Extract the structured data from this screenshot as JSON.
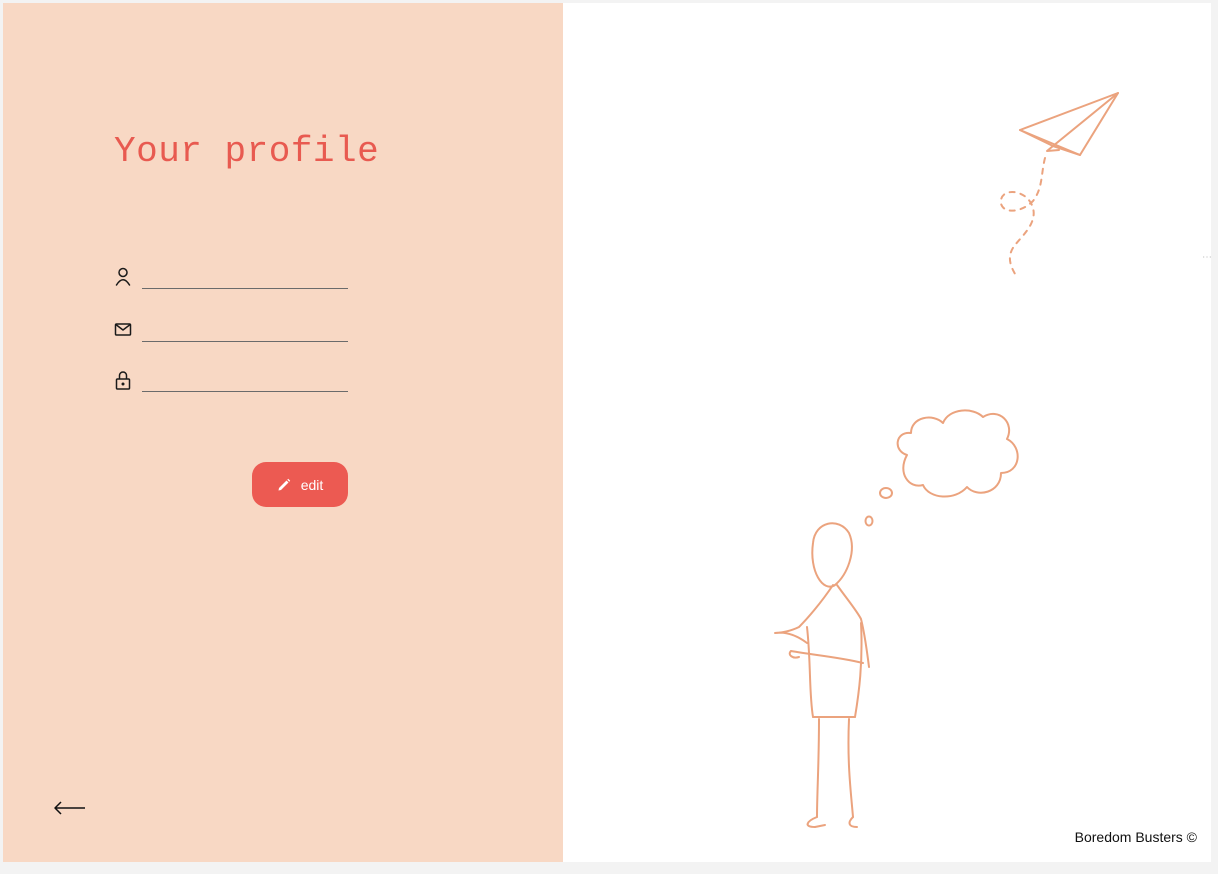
{
  "page": {
    "title": "Your profile"
  },
  "form": {
    "username": {
      "value": "",
      "placeholder": "",
      "icon": "user-icon"
    },
    "email": {
      "value": "",
      "placeholder": "",
      "icon": "mail-icon"
    },
    "password": {
      "value": "",
      "placeholder": "",
      "icon": "lock-icon"
    }
  },
  "edit_button": {
    "label": "edit",
    "icon": "pencil-icon"
  },
  "navigation": {
    "back_icon": "arrow-left-icon"
  },
  "footer": {
    "credit": "Boredom Busters ©"
  },
  "colors": {
    "panel_background": "#f8d8c4",
    "accent": "#ec5a52",
    "title": "#e85a50",
    "sketch": "#eba37e"
  }
}
